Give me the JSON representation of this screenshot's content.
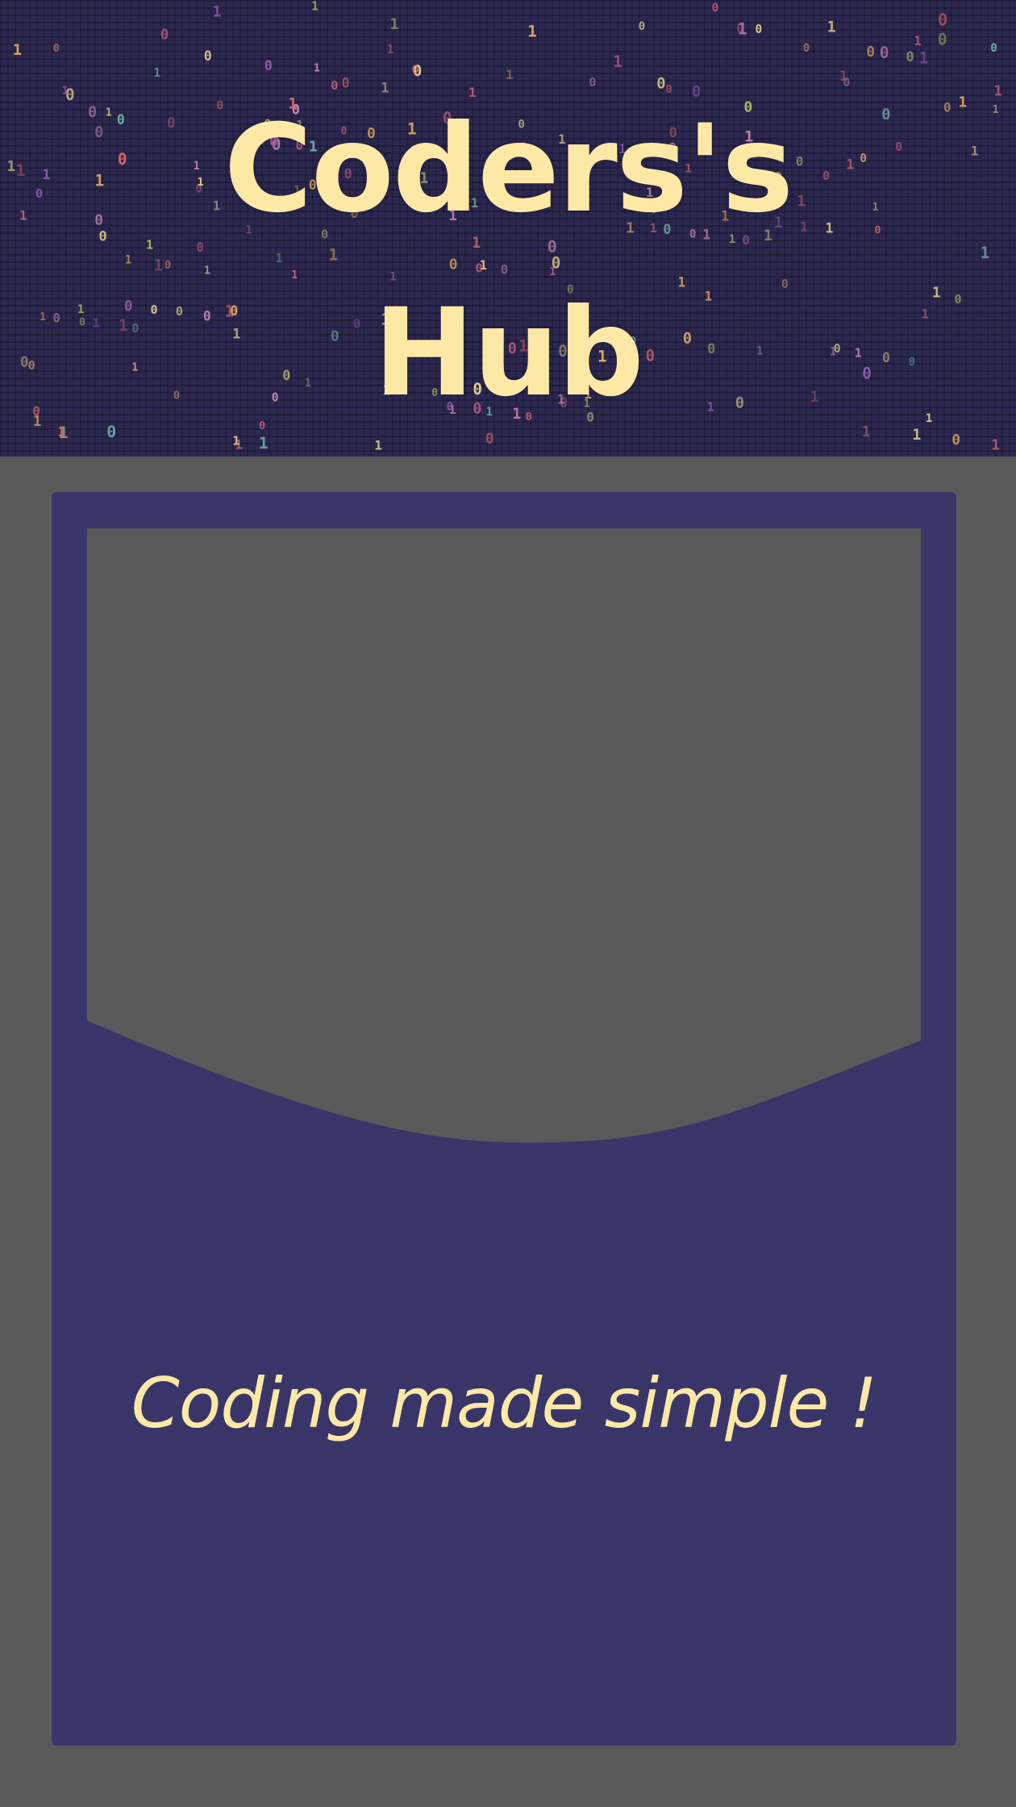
{
  "header": {
    "title": "Coders's\nHub"
  },
  "card": {
    "tagline": "Coding made simple !"
  },
  "colors": {
    "page_background": "#595959",
    "header_background": "#2c2850",
    "card_background": "#3a3569",
    "accent_text": "#fde9a5"
  }
}
